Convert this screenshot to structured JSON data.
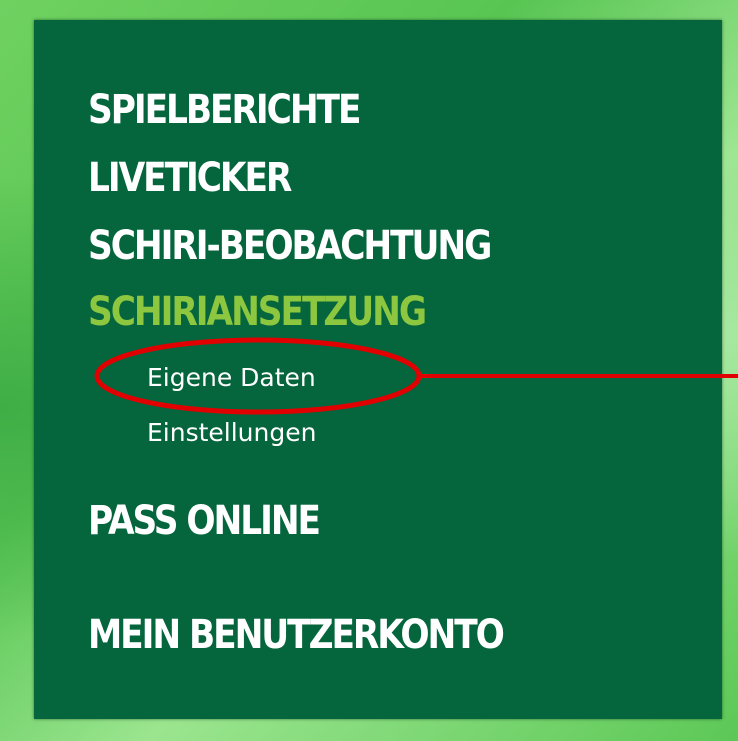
{
  "menu": {
    "items": [
      {
        "label": "SPIELBERICHTE"
      },
      {
        "label": "LIVETICKER"
      },
      {
        "label": "SCHIRI-BEOBACHTUNG"
      },
      {
        "label": "SCHIRIANSETZUNG",
        "active": true
      },
      {
        "label": "PASS ONLINE"
      },
      {
        "label": "MEIN BENUTZERKONTO"
      }
    ],
    "submenu": [
      {
        "label": "Eigene Daten",
        "highlighted": true
      },
      {
        "label": "Einstellungen"
      }
    ]
  },
  "colors": {
    "panel_background": "#05663d",
    "frame_green": "#5cc856",
    "active_item": "#8dc63f",
    "text": "#ffffff",
    "annotation": "#e00000"
  }
}
